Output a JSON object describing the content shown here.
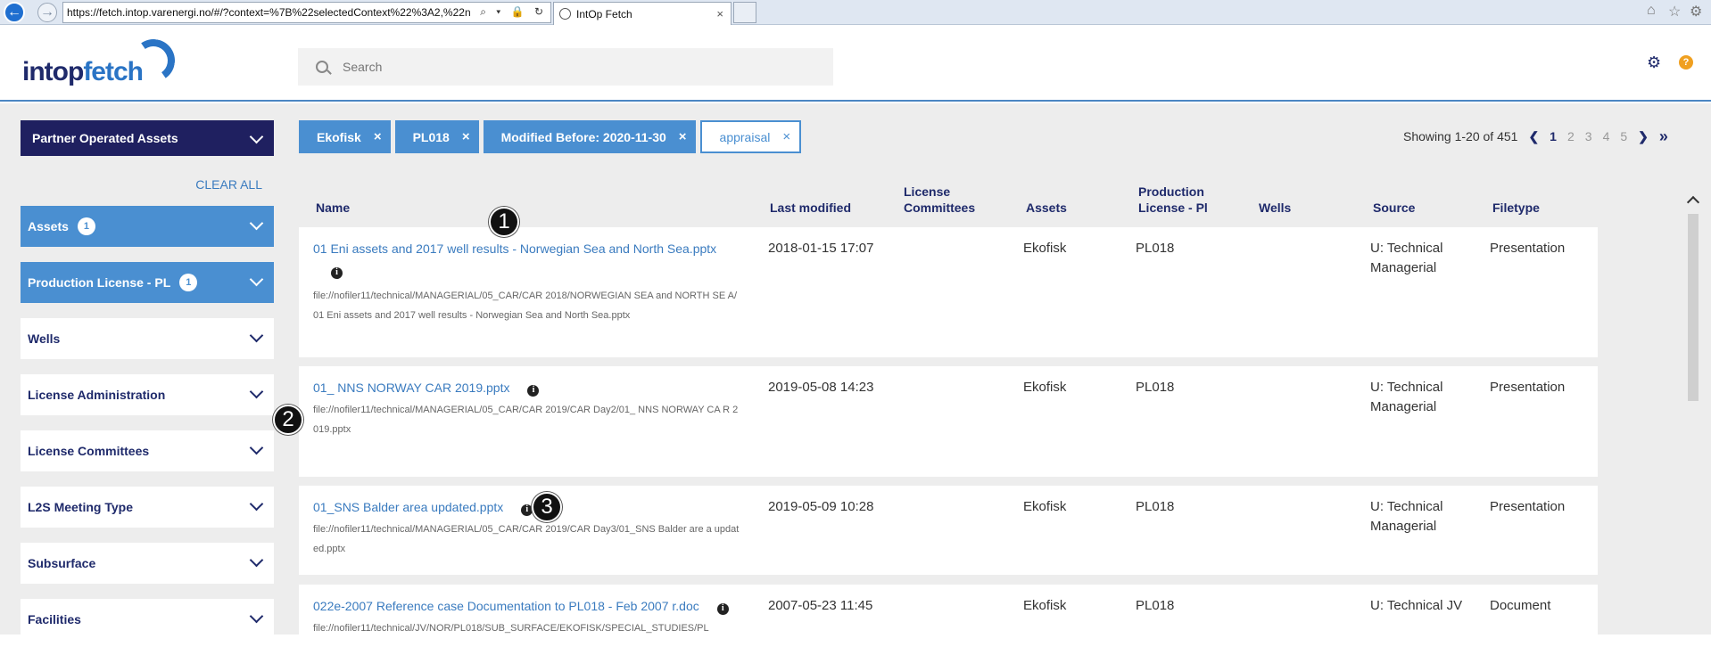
{
  "browser": {
    "url": "https://fetch.intop.varenergi.no/#/?context=%7B%22selectedContext%22%3A2,%22n",
    "tab_title": "IntOp Fetch",
    "back_glyph": "←",
    "forward_glyph": "→",
    "tab_close_glyph": "×",
    "right_icons": [
      "home-icon",
      "star-icon",
      "gear-icon"
    ]
  },
  "header": {
    "logo_part1": "intop",
    "logo_part2": "fetch",
    "search_placeholder": "Search"
  },
  "sidebar": {
    "context_label": "Partner Operated Assets",
    "clear_all": "CLEAR ALL",
    "facets": [
      {
        "label": "Assets",
        "count": "1",
        "active": true
      },
      {
        "label": "Production License - PL",
        "count": "1",
        "active": true
      },
      {
        "label": "Wells",
        "active": false
      },
      {
        "label": "License Administration",
        "active": false
      },
      {
        "label": "License Committees",
        "active": false
      },
      {
        "label": "L2S Meeting Type",
        "active": false
      },
      {
        "label": "Subsurface",
        "active": false
      },
      {
        "label": "Facilities",
        "active": false
      }
    ]
  },
  "filters": {
    "chips": [
      {
        "label": "Ekofisk"
      },
      {
        "label": "PL018"
      },
      {
        "label": "Modified Before: 2020-11-30"
      },
      {
        "label": "appraisal"
      }
    ],
    "remove_glyph": "×"
  },
  "pager": {
    "showing": "Showing 1-20 of 451",
    "prev": "❮",
    "pages": [
      "1",
      "2",
      "3",
      "4",
      "5"
    ],
    "current": "1",
    "next": "❯",
    "last": "»"
  },
  "columns": {
    "name": "Name",
    "last_modified": "Last modified",
    "license_committees": "License Committees",
    "assets": "Assets",
    "production_license": "Production License - Pl",
    "wells": "Wells",
    "source": "Source",
    "filetype": "Filetype"
  },
  "results": [
    {
      "name": "01 Eni assets and 2017 well results - Norwegian Sea and North Sea.pptx",
      "path": "file://nofiler11/technical/MANAGERIAL/05_CAR/CAR 2018/NORWEGIAN SEA and NORTH SE A/01 Eni assets and 2017 well results - Norwegian Sea and North Sea.pptx",
      "modified": "2018-01-15 17:07",
      "assets": "Ekofisk",
      "pl": "PL018",
      "source": "U: Technical Managerial",
      "filetype": "Presentation"
    },
    {
      "name": "01_ NNS NORWAY CAR 2019.pptx",
      "path": "file://nofiler11/technical/MANAGERIAL/05_CAR/CAR 2019/CAR Day2/01_ NNS NORWAY CA R 2019.pptx",
      "modified": "2019-05-08 14:23",
      "assets": "Ekofisk",
      "pl": "PL018",
      "source": "U: Technical Managerial",
      "filetype": "Presentation"
    },
    {
      "name": "01_SNS Balder area updated.pptx",
      "path": "file://nofiler11/technical/MANAGERIAL/05_CAR/CAR 2019/CAR Day3/01_SNS Balder are a updated.pptx",
      "modified": "2019-05-09 10:28",
      "assets": "Ekofisk",
      "pl": "PL018",
      "source": "U: Technical Managerial",
      "filetype": "Presentation"
    },
    {
      "name": "022e-2007 Reference case Documentation to PL018 - Feb 2007 r.doc",
      "path": "file://nofiler11/technical/JV/NOR/PL018/SUB_SURFACE/EKOFISK/SPECIAL_STUDIES/PL",
      "modified": "2007-05-23 11:45",
      "assets": "Ekofisk",
      "pl": "PL018",
      "source": "U: Technical JV",
      "filetype": "Document"
    }
  ],
  "info_glyph": "i",
  "markers": [
    "1",
    "2",
    "3"
  ]
}
